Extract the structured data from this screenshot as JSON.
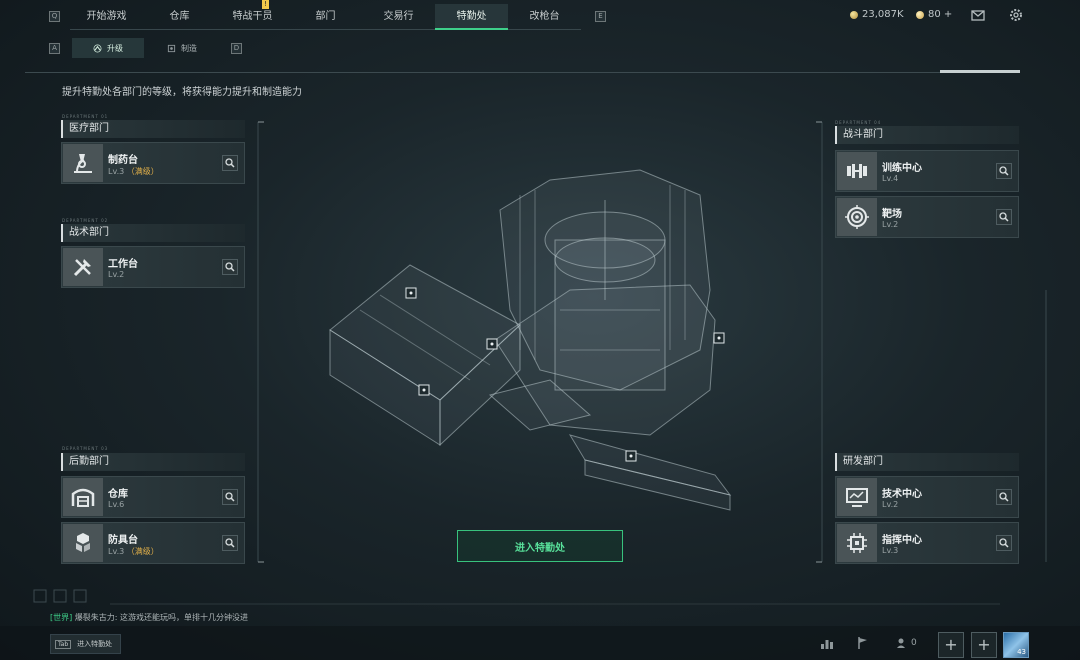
{
  "nav": {
    "tabs": [
      {
        "label": "开始游戏",
        "active": false
      },
      {
        "label": "仓库",
        "active": false
      },
      {
        "label": "特战干员",
        "active": false,
        "alert": "!"
      },
      {
        "label": "部门",
        "active": false
      },
      {
        "label": "交易行",
        "active": false
      },
      {
        "label": "特勤处",
        "active": true
      },
      {
        "label": "改枪台",
        "active": false
      }
    ],
    "prev_key": "Q",
    "next_key": "E",
    "currency1": "23,087K",
    "currency2": "80 +",
    "mail_icon": "mail-icon",
    "settings_icon": "gear-icon"
  },
  "subnav": {
    "prev_key": "A",
    "next_key": "D",
    "tabs": [
      {
        "label": "升级",
        "active": true,
        "icon": "upgrade-icon"
      },
      {
        "label": "制造",
        "active": false,
        "icon": "craft-icon"
      }
    ]
  },
  "subtitle": "提升特勤处各部门的等级，将获得能力提升和制造能力",
  "departments": {
    "medical": {
      "title": "医疗部门",
      "tag": "DEPARTMENT 01",
      "items": [
        {
          "name": "制药台",
          "level": "Lv.3",
          "max": "（满级）",
          "icon": "microscope-icon"
        }
      ]
    },
    "tactical": {
      "title": "战术部门",
      "tag": "DEPARTMENT 02",
      "items": [
        {
          "name": "工作台",
          "level": "Lv.2",
          "max": "",
          "icon": "tools-icon"
        }
      ]
    },
    "logistics": {
      "title": "后勤部门",
      "tag": "DEPARTMENT 03",
      "items": [
        {
          "name": "仓库",
          "level": "Lv.6",
          "max": "",
          "icon": "warehouse-icon"
        },
        {
          "name": "防具台",
          "level": "Lv.3",
          "max": "（满级）",
          "icon": "armor-icon"
        }
      ]
    },
    "combat": {
      "title": "战斗部门",
      "tag": "DEPARTMENT 04",
      "items": [
        {
          "name": "训练中心",
          "level": "Lv.4",
          "max": "",
          "icon": "dumbbell-icon"
        },
        {
          "name": "靶场",
          "level": "Lv.2",
          "max": "",
          "icon": "target-icon"
        }
      ]
    },
    "research": {
      "title": "研发部门",
      "tag": "",
      "items": [
        {
          "name": "技术中心",
          "level": "Lv.2",
          "max": "",
          "icon": "monitor-icon"
        },
        {
          "name": "指挥中心",
          "level": "Lv.3",
          "max": "",
          "icon": "chip-icon"
        }
      ]
    }
  },
  "enter_button": "进入特勤处",
  "chat": {
    "channel": "[世界]",
    "user": "爆裂朱古力:",
    "message": "这游戏还能玩吗，单排十几分钟没进"
  },
  "tab_hint": {
    "key": "Tab",
    "label": "进入特勤处"
  },
  "bottom": {
    "friends_count": "0",
    "avatar_level": "43"
  }
}
